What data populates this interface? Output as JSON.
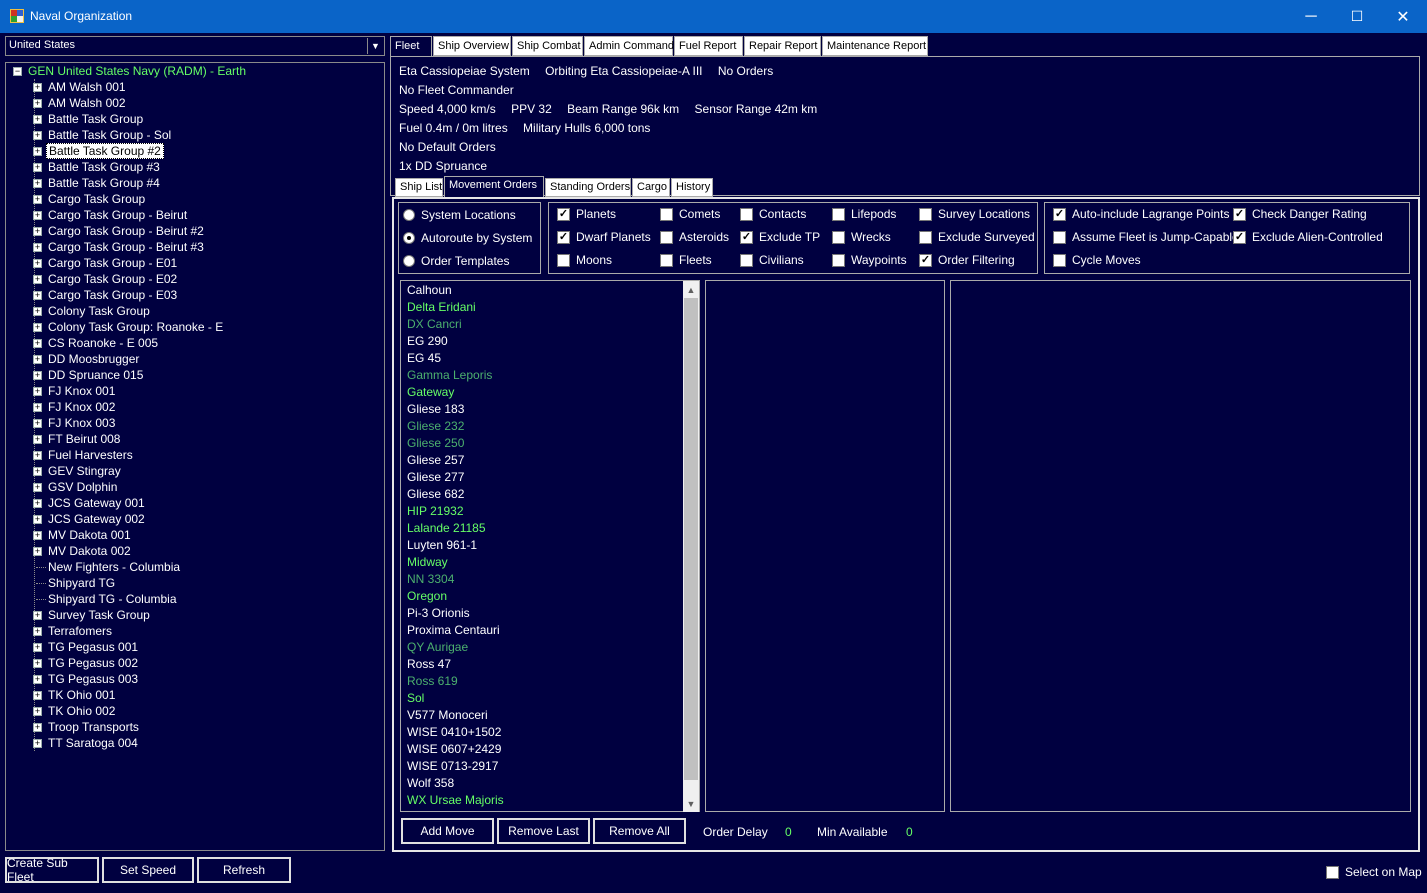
{
  "window": {
    "title": "Naval Organization",
    "minimize": "─",
    "maximize": "☐",
    "close": "✕"
  },
  "left": {
    "country": "United States",
    "tree_root": "GEN United States Navy  (RADM)  -  Earth",
    "tree_items": [
      {
        "label": "AM Walsh 001",
        "exp": true
      },
      {
        "label": "AM Walsh 002",
        "exp": true
      },
      {
        "label": "Battle Task Group",
        "exp": true
      },
      {
        "label": "Battle Task Group - Sol",
        "exp": true
      },
      {
        "label": "Battle Task Group #2",
        "exp": true,
        "selected": true
      },
      {
        "label": "Battle Task Group #3",
        "exp": true
      },
      {
        "label": "Battle Task Group #4",
        "exp": true
      },
      {
        "label": "Cargo Task Group",
        "exp": true
      },
      {
        "label": "Cargo Task Group - Beirut",
        "exp": true
      },
      {
        "label": "Cargo Task Group - Beirut #2",
        "exp": true
      },
      {
        "label": "Cargo Task Group - Beirut #3",
        "exp": true
      },
      {
        "label": "Cargo Task Group - E01",
        "exp": true
      },
      {
        "label": "Cargo Task Group - E02",
        "exp": true
      },
      {
        "label": "Cargo Task Group - E03",
        "exp": true
      },
      {
        "label": "Colony Task Group",
        "exp": true
      },
      {
        "label": "Colony Task Group: Roanoke - E",
        "exp": true
      },
      {
        "label": "CS Roanoke - E 005",
        "exp": true
      },
      {
        "label": "DD Moosbrugger",
        "exp": true
      },
      {
        "label": "DD Spruance 015",
        "exp": true
      },
      {
        "label": "FJ Knox 001",
        "exp": true
      },
      {
        "label": "FJ Knox 002",
        "exp": true
      },
      {
        "label": "FJ Knox 003",
        "exp": true
      },
      {
        "label": "FT Beirut 008",
        "exp": true
      },
      {
        "label": "Fuel Harvesters",
        "exp": true
      },
      {
        "label": "GEV Stingray",
        "exp": true
      },
      {
        "label": "GSV Dolphin",
        "exp": true
      },
      {
        "label": "JCS Gateway 001",
        "exp": true
      },
      {
        "label": "JCS Gateway 002",
        "exp": true
      },
      {
        "label": "MV Dakota 001",
        "exp": true
      },
      {
        "label": "MV Dakota 002",
        "exp": true
      },
      {
        "label": "New Fighters - Columbia",
        "exp": false
      },
      {
        "label": "Shipyard TG",
        "exp": false
      },
      {
        "label": "Shipyard TG - Columbia",
        "exp": false
      },
      {
        "label": "Survey Task Group",
        "exp": true
      },
      {
        "label": "Terrafomers",
        "exp": true
      },
      {
        "label": "TG Pegasus 001",
        "exp": true
      },
      {
        "label": "TG Pegasus 002",
        "exp": true
      },
      {
        "label": "TG Pegasus 003",
        "exp": true
      },
      {
        "label": "TK Ohio 001",
        "exp": true
      },
      {
        "label": "TK Ohio 002",
        "exp": true
      },
      {
        "label": "Troop Transports",
        "exp": true
      },
      {
        "label": "TT Saratoga 004",
        "exp": true
      }
    ],
    "buttons": {
      "create_sub_fleet": "Create Sub Fleet",
      "set_speed": "Set Speed",
      "refresh": "Refresh"
    }
  },
  "tabs": [
    "Fleet",
    "Ship Overview",
    "Ship Combat",
    "Admin Command",
    "Fuel Report",
    "Repair Report",
    "Maintenance Report"
  ],
  "fleet_info": {
    "line1": [
      "Eta Cassiopeiae System",
      "Orbiting Eta Cassiopeiae-A III",
      "No Orders"
    ],
    "line2": "No Fleet Commander",
    "line3": [
      "Speed 4,000 km/s",
      "PPV 32",
      "Beam Range 96k  km",
      "Sensor Range 42m  km"
    ],
    "line4": [
      "Fuel 0.4m / 0m litres",
      "Military Hulls 6,000 tons"
    ],
    "line5": "No Default Orders",
    "line6": "1x DD Spruance"
  },
  "subtabs": [
    "Ship List",
    "Movement Orders",
    "Standing Orders",
    "Cargo",
    "History"
  ],
  "radios": [
    {
      "label": "System Locations",
      "checked": false
    },
    {
      "label": "Autoroute by System",
      "checked": true
    },
    {
      "label": "Order Templates",
      "checked": false
    }
  ],
  "filters": [
    {
      "label": "Planets",
      "checked": true
    },
    {
      "label": "Comets",
      "checked": false
    },
    {
      "label": "Contacts",
      "checked": false
    },
    {
      "label": "Lifepods",
      "checked": false
    },
    {
      "label": "Survey Locations",
      "checked": false
    },
    {
      "label": "Dwarf Planets",
      "checked": true
    },
    {
      "label": "Asteroids",
      "checked": false
    },
    {
      "label": "Exclude TP",
      "checked": true
    },
    {
      "label": "Wrecks",
      "checked": false
    },
    {
      "label": "Exclude Surveyed",
      "checked": false
    },
    {
      "label": "Moons",
      "checked": false
    },
    {
      "label": "Fleets",
      "checked": false
    },
    {
      "label": "Civilians",
      "checked": false
    },
    {
      "label": "Waypoints",
      "checked": false
    },
    {
      "label": "Order Filtering",
      "checked": true
    }
  ],
  "options": [
    {
      "label": "Auto-include Lagrange Points",
      "checked": true
    },
    {
      "label": "Check Danger Rating",
      "checked": true
    },
    {
      "label": "Assume Fleet is Jump-Capable",
      "checked": false
    },
    {
      "label": "Exclude Alien-Controlled",
      "checked": true
    },
    {
      "label": "Cycle Moves",
      "checked": false
    }
  ],
  "systems": [
    {
      "name": "Calhoun",
      "color": "white"
    },
    {
      "name": "Delta Eridani",
      "color": "green"
    },
    {
      "name": "DX Cancri",
      "color": "dim"
    },
    {
      "name": "EG 290",
      "color": "white"
    },
    {
      "name": "EG 45",
      "color": "white"
    },
    {
      "name": "Gamma Leporis",
      "color": "dim"
    },
    {
      "name": "Gateway",
      "color": "green"
    },
    {
      "name": "Gliese 183",
      "color": "white"
    },
    {
      "name": "Gliese 232",
      "color": "dim"
    },
    {
      "name": "Gliese 250",
      "color": "dim"
    },
    {
      "name": "Gliese 257",
      "color": "white"
    },
    {
      "name": "Gliese 277",
      "color": "white"
    },
    {
      "name": "Gliese 682",
      "color": "white"
    },
    {
      "name": "HIP 21932",
      "color": "green"
    },
    {
      "name": "Lalande 21185",
      "color": "green"
    },
    {
      "name": "Luyten 961-1",
      "color": "white"
    },
    {
      "name": "Midway",
      "color": "green"
    },
    {
      "name": "NN 3304",
      "color": "dim"
    },
    {
      "name": "Oregon",
      "color": "green"
    },
    {
      "name": "Pi-3 Orionis",
      "color": "white"
    },
    {
      "name": "Proxima Centauri",
      "color": "white"
    },
    {
      "name": "QY Aurigae",
      "color": "dim"
    },
    {
      "name": "Ross 47",
      "color": "white"
    },
    {
      "name": "Ross 619",
      "color": "dim"
    },
    {
      "name": "Sol",
      "color": "green"
    },
    {
      "name": "V577 Monoceri",
      "color": "white"
    },
    {
      "name": "WISE 0410+1502",
      "color": "white"
    },
    {
      "name": "WISE 0607+2429",
      "color": "white"
    },
    {
      "name": "WISE 0713-2917",
      "color": "white"
    },
    {
      "name": "Wolf 358",
      "color": "white"
    },
    {
      "name": "WX Ursae Majoris",
      "color": "green"
    }
  ],
  "bottom": {
    "add_move": "Add Move",
    "remove_last": "Remove Last",
    "remove_all": "Remove All",
    "order_delay_label": "Order Delay",
    "order_delay_value": "0",
    "min_available_label": "Min Available",
    "min_available_value": "0",
    "select_on_map": "Select on Map"
  }
}
